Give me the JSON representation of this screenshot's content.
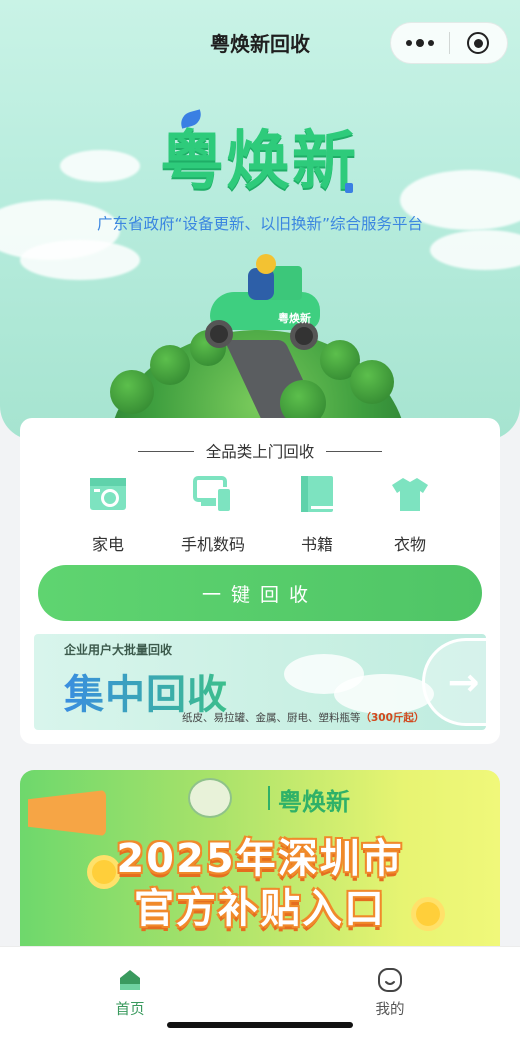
{
  "nav": {
    "title": "粤焕新回收"
  },
  "hero": {
    "logo_text": "粤焕新",
    "subtitle": "广东省政府“设备更新、以旧换新”综合服务平台",
    "scooter_tag": "粤焕新"
  },
  "card": {
    "title": "全品类上门回收",
    "categories": [
      {
        "label": "家电",
        "icon": "appliance-icon"
      },
      {
        "label": "手机数码",
        "icon": "phone-digital-icon"
      },
      {
        "label": "书籍",
        "icon": "book-icon"
      },
      {
        "label": "衣物",
        "icon": "clothes-icon"
      }
    ],
    "one_key_label": "一键回收"
  },
  "bulk": {
    "small_title": "企业用户大批量回收",
    "big_title": "集中回收",
    "desc": "纸皮、易拉罐、金属、厨电、塑料瓶等",
    "desc_highlight": "（300斤起）",
    "arrow": "→"
  },
  "banner": {
    "brand": "粤焕新",
    "line1": "2025年深圳市",
    "line2": "官方补贴入口"
  },
  "tabbar": {
    "items": [
      {
        "label": "首页",
        "active": true,
        "icon": "home-icon"
      },
      {
        "label": "我的",
        "active": false,
        "icon": "profile-icon"
      }
    ]
  },
  "colors": {
    "accent": "#4fc566",
    "tab_active": "#3a9a5e",
    "subtitle_blue": "#3b86e0",
    "icon_mint": "#7de3c0"
  }
}
